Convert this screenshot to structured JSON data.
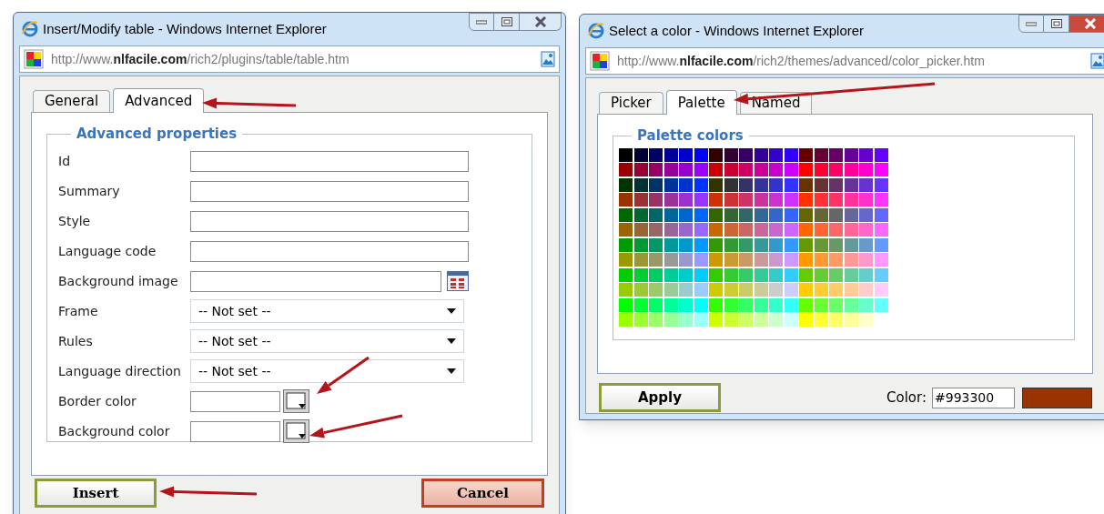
{
  "table_dialog": {
    "title": "Insert/Modify table - Windows Internet Explorer",
    "address": "http://www.**nlfacile.com**/rich2/plugins/table/table.htm",
    "tabs": [
      {
        "label": "General",
        "selected": false
      },
      {
        "label": "Advanced",
        "selected": true
      }
    ],
    "legend": "Advanced properties",
    "fields": [
      {
        "label": "Id",
        "kind": "text"
      },
      {
        "label": "Summary",
        "kind": "text"
      },
      {
        "label": "Style",
        "kind": "text"
      },
      {
        "label": "Language code",
        "kind": "text"
      },
      {
        "label": "Background image",
        "kind": "browse"
      },
      {
        "label": "Frame",
        "kind": "select",
        "value": "-- Not set --"
      },
      {
        "label": "Rules",
        "kind": "select",
        "value": "-- Not set --"
      },
      {
        "label": "Language direction",
        "kind": "select",
        "value": "-- Not set --"
      },
      {
        "label": "Border color",
        "kind": "color"
      },
      {
        "label": "Background color",
        "kind": "color"
      }
    ],
    "insert_button": "Insert",
    "cancel_button": "Cancel"
  },
  "color_dialog": {
    "title": "Select a color - Windows Internet Explorer",
    "address": "http://www.**nlfacile.com**/rich2/themes/advanced/color_picker.htm",
    "tabs": [
      {
        "label": "Picker",
        "selected": false
      },
      {
        "label": "Palette",
        "selected": true
      },
      {
        "label": "Named",
        "selected": false
      }
    ],
    "legend": "Palette colors",
    "apply_button": "Apply",
    "color_label": "Color:",
    "color_value": "#993300"
  }
}
